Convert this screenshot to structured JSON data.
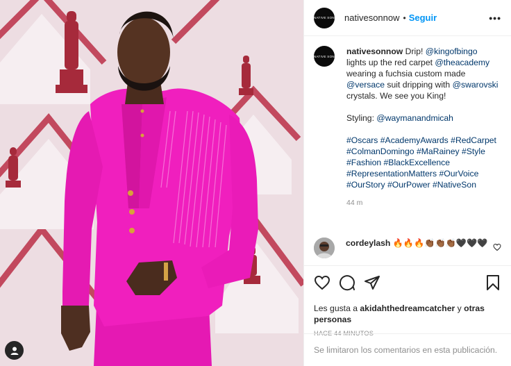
{
  "post": {
    "username": "nativesonnow",
    "follow_separator": "•",
    "follow_label": "Seguir",
    "more_label": "•••",
    "avatar_text": "NATIVE SON"
  },
  "caption": {
    "username": "nativesonnow",
    "segments": [
      " Drip! ",
      "@kingofbingo",
      " lights up the red carpet ",
      "@theacademy",
      " wearing a fuchsia custom made ",
      "@versace",
      " suit dripping with ",
      "@swarovski",
      " crystals. We see you King!"
    ],
    "styling_label": "Styling: ",
    "styling_handle": "@waymanandmicah",
    "hashtags": [
      "#Oscars",
      "#AcademyAwards",
      "#RedCarpet",
      "#ColmanDomingo",
      "#MaRainey",
      "#Style",
      "#Fashion",
      "#BlackExcellence",
      "#RepresentationMatters",
      "#OurVoice",
      "#OurStory",
      "#OurPower",
      "#NativeSon"
    ],
    "timestamp": "44 m"
  },
  "comment": {
    "username": "cordeylash",
    "text": " 🔥🔥🔥👏🏾👏🏾👏🏾🖤🖤🖤"
  },
  "likes": {
    "prefix": "Les gusta a ",
    "user": "akidahthedreamcatcher",
    "middle": " y ",
    "others": "otras personas"
  },
  "time_ago": "HACE 44 MINUTOS",
  "footer_text": "Se limitaron los comentarios en esta publicación.",
  "colors": {
    "link": "#00376b",
    "follow": "#0095f6",
    "suit": "#f21cbf",
    "backdrop": "#eedde2",
    "accent_red": "#c2495e"
  },
  "icons": {
    "like": "heart-icon",
    "comment": "comment-bubble-icon",
    "share": "paper-plane-icon",
    "save": "bookmark-icon",
    "tag": "user-tag-icon"
  }
}
